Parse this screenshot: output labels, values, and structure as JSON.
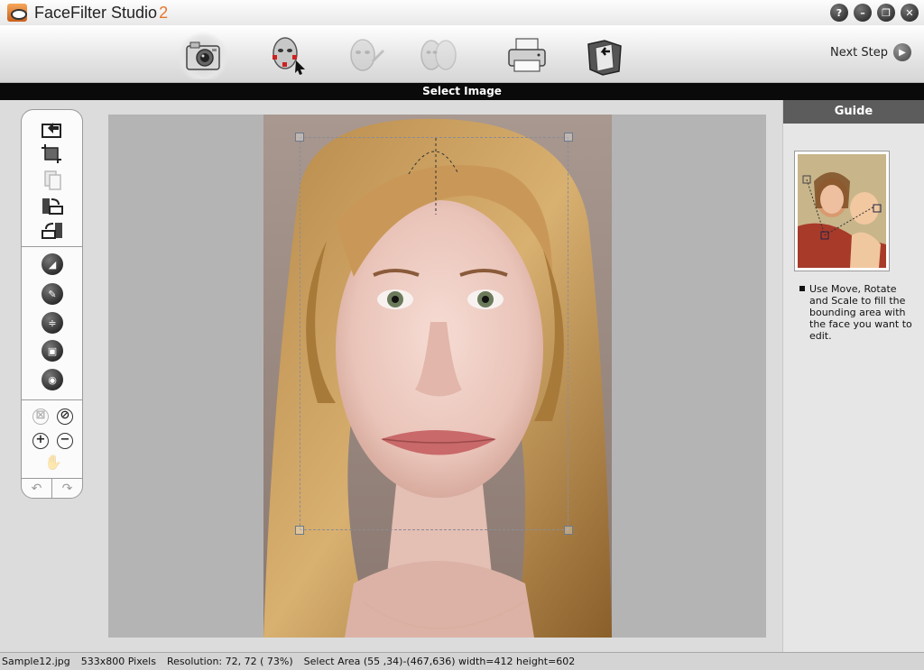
{
  "app": {
    "title": "FaceFilter Studio",
    "version": "2"
  },
  "window_buttons": [
    "?",
    "–",
    "❐",
    "✕"
  ],
  "toolbar": {
    "steps": [
      {
        "name": "camera-icon",
        "active": true
      },
      {
        "name": "face-marker-icon",
        "active": false
      },
      {
        "name": "face-edit-icon",
        "active": false
      },
      {
        "name": "face-morph-icon",
        "active": false
      },
      {
        "name": "printer-icon",
        "active": false
      },
      {
        "name": "export-folder-icon",
        "active": false
      }
    ],
    "next_step": "Next Step"
  },
  "step_title": "Select Image",
  "guide": {
    "header": "Guide",
    "text": "Use Move, Rotate and Scale to fill the bounding area with the face you want to edit."
  },
  "status": {
    "filename": "Sample12.jpg",
    "dimensions": "533x800 Pixels",
    "resolution": "Resolution: 72, 72 ( 73%)",
    "selection": "Select Area (55 ,34)-(467,636) width=412  height=602"
  },
  "colors": {
    "accent": "#e8762a",
    "strip": "#0a0a0a",
    "guide_header": "#5c5c5c"
  }
}
